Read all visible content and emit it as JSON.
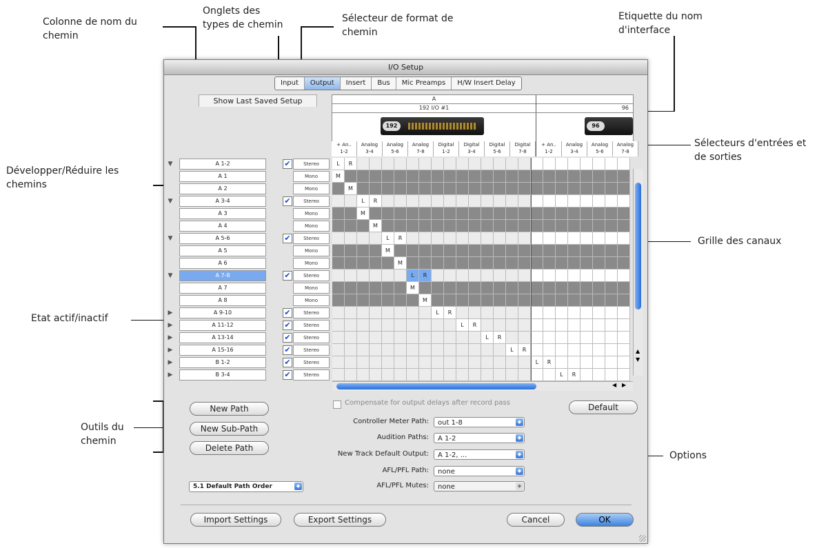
{
  "callouts": {
    "path_name_column": [
      "Colonne de nom du",
      "chemin"
    ],
    "path_type_tabs": [
      "Onglets des",
      "types de chemin"
    ],
    "path_format_selector": [
      "Sélecteur de format de",
      "chemin"
    ],
    "interface_name_label": [
      "Etiquette du nom",
      "d'interface"
    ],
    "input_output_selectors": [
      "Sélecteurs d'entrées et",
      "de sorties"
    ],
    "expand_collapse": [
      "Développer/Réduire  les",
      "chemins"
    ],
    "channel_grid": "Grille des canaux",
    "active_inactive": "Etat actif/inactif",
    "path_tools": [
      "Outils du",
      "chemin"
    ],
    "options": "Options"
  },
  "dialog": {
    "title": "I/O Setup",
    "tabs": [
      "Input",
      "Output",
      "Insert",
      "Bus",
      "Mic Preamps",
      "H/W Insert Delay"
    ],
    "active_tab": "Output",
    "show_last_saved": "Show Last Saved Setup",
    "header": {
      "group_a": "A",
      "interface_1": "192 I/O #1",
      "interface_2": "96",
      "device_1_badge": "192",
      "device_2_badge": "96"
    },
    "channel_columns": [
      [
        "+ An..",
        "1-2"
      ],
      [
        "Analog",
        "3-4"
      ],
      [
        "Analog",
        "5-6"
      ],
      [
        "Analog",
        "7-8"
      ],
      [
        "Digital",
        "1-2"
      ],
      [
        "Digital",
        "3-4"
      ],
      [
        "Digital",
        "5-6"
      ],
      [
        "Digital",
        "7-8"
      ],
      [
        "+ An..",
        "1-2"
      ],
      [
        "Analog",
        "3-4"
      ],
      [
        "Analog",
        "5-6"
      ],
      [
        "Analog",
        "7-8"
      ]
    ],
    "paths": [
      {
        "name": "A 1-2",
        "format": "Stereo",
        "arrow": "▼",
        "active": true,
        "cells": [
          [
            0,
            "L"
          ],
          [
            1,
            "R"
          ]
        ]
      },
      {
        "name": "A 1",
        "format": "Mono",
        "arrow": "",
        "active": false,
        "cells": [
          [
            0,
            "M"
          ]
        ]
      },
      {
        "name": "A 2",
        "format": "Mono",
        "arrow": "",
        "active": false,
        "cells": [
          [
            1,
            "M"
          ]
        ]
      },
      {
        "name": "A 3-4",
        "format": "Stereo",
        "arrow": "▼",
        "active": true,
        "cells": [
          [
            2,
            "L"
          ],
          [
            3,
            "R"
          ]
        ]
      },
      {
        "name": "A 3",
        "format": "Mono",
        "arrow": "",
        "active": false,
        "cells": [
          [
            2,
            "M"
          ]
        ]
      },
      {
        "name": "A 4",
        "format": "Mono",
        "arrow": "",
        "active": false,
        "cells": [
          [
            3,
            "M"
          ]
        ]
      },
      {
        "name": "A 5-6",
        "format": "Stereo",
        "arrow": "▼",
        "active": true,
        "cells": [
          [
            4,
            "L"
          ],
          [
            5,
            "R"
          ]
        ]
      },
      {
        "name": "A 5",
        "format": "Mono",
        "arrow": "",
        "active": false,
        "cells": [
          [
            4,
            "M"
          ]
        ]
      },
      {
        "name": "A 6",
        "format": "Mono",
        "arrow": "",
        "active": false,
        "cells": [
          [
            5,
            "M"
          ]
        ]
      },
      {
        "name": "A 7-8",
        "format": "Stereo",
        "arrow": "▼",
        "active": true,
        "selected": true,
        "cells": [
          [
            6,
            "L"
          ],
          [
            7,
            "R"
          ]
        ]
      },
      {
        "name": "A 7",
        "format": "Mono",
        "arrow": "",
        "active": false,
        "cells": [
          [
            6,
            "M"
          ]
        ]
      },
      {
        "name": "A 8",
        "format": "Mono",
        "arrow": "",
        "active": false,
        "cells": [
          [
            7,
            "M"
          ]
        ]
      },
      {
        "name": "A 9-10",
        "format": "Stereo",
        "arrow": "▶",
        "active": true,
        "cells": [
          [
            8,
            "L"
          ],
          [
            9,
            "R"
          ]
        ]
      },
      {
        "name": "A 11-12",
        "format": "Stereo",
        "arrow": "▶",
        "active": true,
        "cells": [
          [
            10,
            "L"
          ],
          [
            11,
            "R"
          ]
        ]
      },
      {
        "name": "A 13-14",
        "format": "Stereo",
        "arrow": "▶",
        "active": true,
        "cells": [
          [
            12,
            "L"
          ],
          [
            13,
            "R"
          ]
        ]
      },
      {
        "name": "A 15-16",
        "format": "Stereo",
        "arrow": "▶",
        "active": true,
        "cells": [
          [
            14,
            "L"
          ],
          [
            15,
            "R"
          ]
        ]
      },
      {
        "name": "B 1-2",
        "format": "Stereo",
        "arrow": "▶",
        "active": true,
        "cells": [
          [
            16,
            "L"
          ],
          [
            17,
            "R"
          ]
        ]
      },
      {
        "name": "B 3-4",
        "format": "Stereo",
        "arrow": "▶",
        "active": true,
        "cells": [
          [
            18,
            "L"
          ],
          [
            19,
            "R"
          ]
        ]
      }
    ],
    "compensate_label": "Compensate for output delays after record pass",
    "buttons": {
      "new_path": "New Path",
      "new_sub_path": "New Sub-Path",
      "delete_path": "Delete Path",
      "default": "Default",
      "import": "Import Settings",
      "export": "Export Settings",
      "cancel": "Cancel",
      "ok": "OK"
    },
    "path_order": "5.1 Default Path Order",
    "options": [
      {
        "label": "Controller Meter Path:",
        "value": "out 1-8"
      },
      {
        "label": "Audition Paths:",
        "value": "A 1-2"
      },
      {
        "label": "New Track Default Output:",
        "value": "A 1-2, ..."
      },
      {
        "label": "AFL/PFL Path:",
        "value": "none"
      },
      {
        "label": "AFL/PFL Mutes:",
        "value": "none"
      }
    ]
  }
}
